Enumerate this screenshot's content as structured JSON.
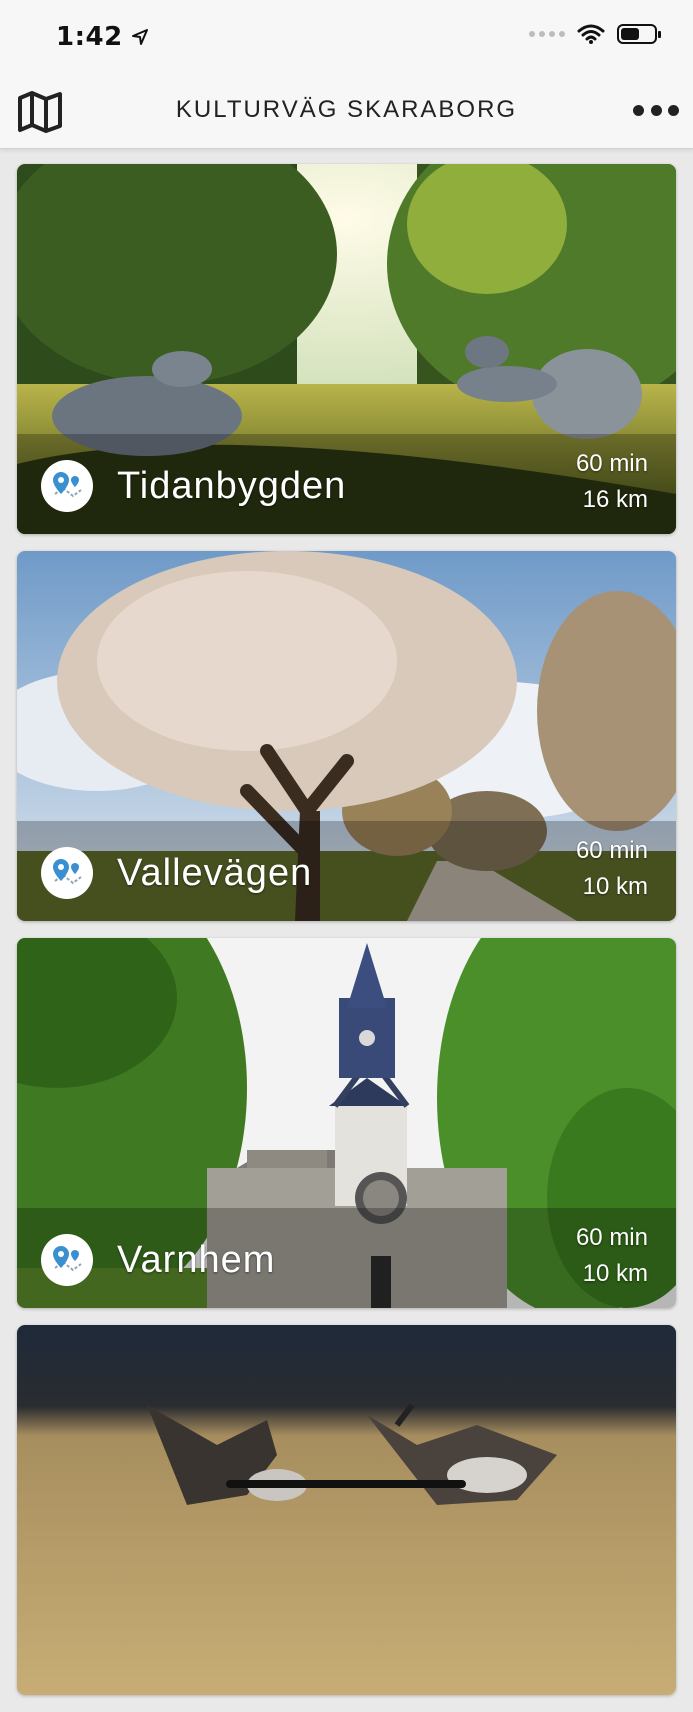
{
  "status_bar": {
    "time": "1:42"
  },
  "header": {
    "title": "KULTURVÄG SKARABORG"
  },
  "routes": [
    {
      "name": "Tidanbygden",
      "duration": "60 min",
      "distance": "16 km"
    },
    {
      "name": "Vallevägen",
      "duration": "60 min",
      "distance": "10 km"
    },
    {
      "name": "Varnhem",
      "duration": "60 min",
      "distance": "10 km"
    },
    {
      "name": "",
      "duration": "",
      "distance": ""
    }
  ],
  "icons": {
    "map": "map-icon",
    "more": "more-icon",
    "route": "route-pin-icon",
    "location": "location-arrow-icon"
  },
  "colors": {
    "pin_accent": "#3a8fd0",
    "header_bg": "#f7f7f7"
  }
}
